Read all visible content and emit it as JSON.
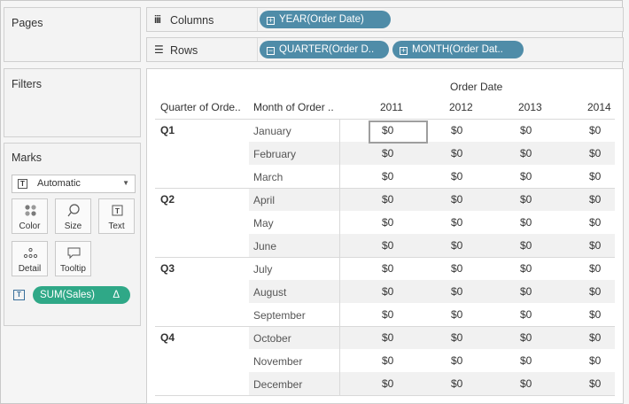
{
  "cards": {
    "pages_title": "Pages",
    "filters_title": "Filters",
    "marks_title": "Marks"
  },
  "marks": {
    "type_value": "Automatic",
    "buttons": [
      {
        "label": "Color",
        "icon": "color-dots-icon"
      },
      {
        "label": "Size",
        "icon": "size-circle-icon"
      },
      {
        "label": "Text",
        "icon": "text-t-icon"
      },
      {
        "label": "Detail",
        "icon": "detail-dots-icon"
      },
      {
        "label": "Tooltip",
        "icon": "tooltip-bubble-icon"
      }
    ],
    "field_pill": "SUM(Sales)",
    "field_pill_delta": "Δ"
  },
  "shelves": {
    "columns_label": "Columns",
    "rows_label": "Rows",
    "columns_pills": [
      "YEAR(Order Date)"
    ],
    "rows_pills": [
      "QUARTER(Order D..",
      "MONTH(Order Dat.."
    ]
  },
  "view": {
    "top_header": "Order Date",
    "row_headers": [
      "Quarter of Orde..",
      "Month of Order .."
    ],
    "years": [
      "2011",
      "2012",
      "2013",
      "2014"
    ],
    "quarters": [
      "Q1",
      "Q2",
      "Q3",
      "Q4"
    ],
    "months": [
      "January",
      "February",
      "March",
      "April",
      "May",
      "June",
      "July",
      "August",
      "September",
      "October",
      "November",
      "December"
    ],
    "values": [
      [
        "$0",
        "$0",
        "$0",
        "$0"
      ],
      [
        "$0",
        "$0",
        "$0",
        "$0"
      ],
      [
        "$0",
        "$0",
        "$0",
        "$0"
      ],
      [
        "$0",
        "$0",
        "$0",
        "$0"
      ],
      [
        "$0",
        "$0",
        "$0",
        "$0"
      ],
      [
        "$0",
        "$0",
        "$0",
        "$0"
      ],
      [
        "$0",
        "$0",
        "$0",
        "$0"
      ],
      [
        "$0",
        "$0",
        "$0",
        "$0"
      ],
      [
        "$0",
        "$0",
        "$0",
        "$0"
      ],
      [
        "$0",
        "$0",
        "$0",
        "$0"
      ],
      [
        "$0",
        "$0",
        "$0",
        "$0"
      ],
      [
        "$0",
        "$0",
        "$0",
        "$0"
      ]
    ]
  },
  "colors": {
    "pill_dimension": "#4f8ca8",
    "pill_measure": "#2fa887"
  }
}
